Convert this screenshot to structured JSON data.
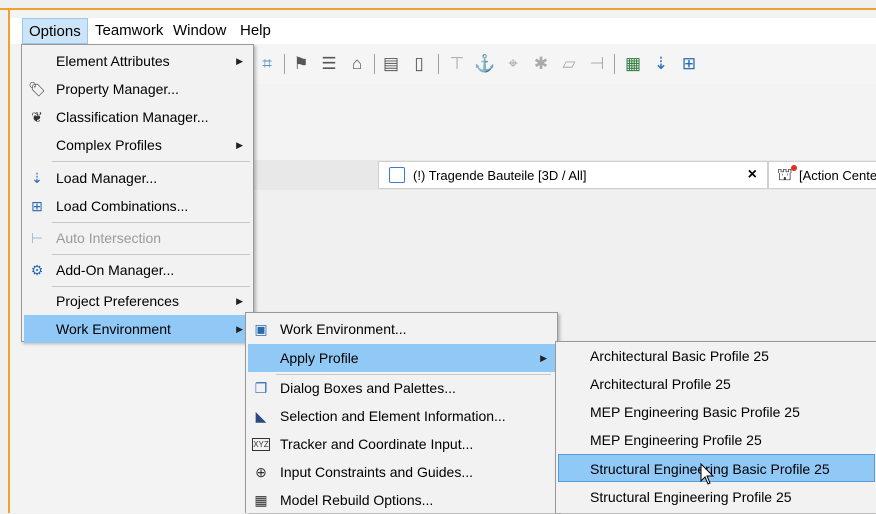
{
  "menubar": {
    "items": [
      {
        "label": "Options"
      },
      {
        "label": "Teamwork"
      },
      {
        "label": "Window"
      },
      {
        "label": "Help"
      }
    ]
  },
  "options_menu": {
    "items": [
      {
        "label": "Element Attributes",
        "icon": "",
        "submenu": true
      },
      {
        "label": "Property Manager...",
        "icon": "tag-icon"
      },
      {
        "label": "Classification Manager...",
        "icon": "classification-tree-icon"
      },
      {
        "label": "Complex Profiles",
        "icon": "",
        "submenu": true
      },
      {
        "label": "Load Manager...",
        "icon": "load-manager-icon"
      },
      {
        "label": "Load Combinations...",
        "icon": "load-combinations-icon"
      },
      {
        "label": "Auto Intersection",
        "icon": "auto-intersection-icon",
        "disabled": true
      },
      {
        "label": "Add-On Manager...",
        "icon": "add-on-manager-icon"
      },
      {
        "label": "Project Preferences",
        "icon": "",
        "submenu": true
      },
      {
        "label": "Work Environment",
        "icon": "",
        "submenu": true,
        "highlighted": true
      }
    ]
  },
  "work_env_menu": {
    "items": [
      {
        "label": "Work Environment...",
        "icon": "work-environment-icon"
      },
      {
        "label": "Apply Profile",
        "submenu": true,
        "highlighted": true
      },
      {
        "label": "Dialog Boxes and Palettes...",
        "icon": "dialog-palettes-icon"
      },
      {
        "label": "Selection and Element Information...",
        "icon": "selection-info-icon"
      },
      {
        "label": "Tracker and Coordinate Input...",
        "icon": "xyz-tracker-icon"
      },
      {
        "label": "Input Constraints and Guides...",
        "icon": "input-constraints-icon"
      },
      {
        "label": "Model Rebuild Options...",
        "icon": "model-rebuild-icon"
      }
    ]
  },
  "profile_menu": {
    "items": [
      {
        "label": "Architectural Basic Profile 25"
      },
      {
        "label": "Architectural Profile 25"
      },
      {
        "label": "MEP Engineering Basic Profile 25"
      },
      {
        "label": "MEP Engineering Profile 25"
      },
      {
        "label": "Structural Engineering Basic Profile 25",
        "highlighted": true
      },
      {
        "label": "Structural Engineering Profile 25"
      }
    ]
  },
  "tabs": [
    {
      "label": "(!) Tragende Bauteile [3D / All]",
      "close": "×"
    },
    {
      "label": "[Action Cente"
    }
  ],
  "colors": {
    "highlight": "#90c8f6",
    "frame": "#f0a030"
  }
}
